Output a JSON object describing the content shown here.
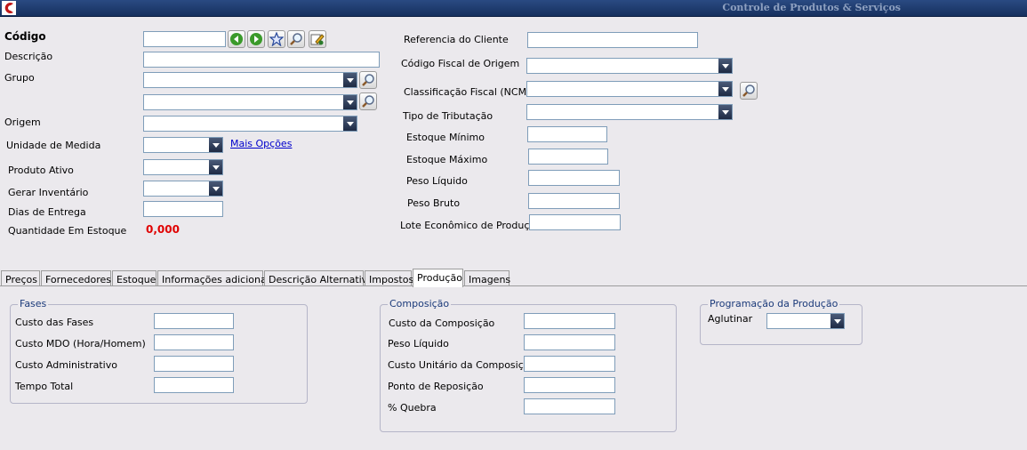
{
  "window": {
    "title": "Controle de Produtos & Serviços"
  },
  "left": {
    "codigo_label": "Código",
    "descricao_label": "Descrição",
    "grupo_label": "Grupo",
    "origem_label": "Origem",
    "unidade_label": "Unidade de Medida",
    "mais_opcoes": "Mais Opções",
    "produto_ativo_label": "Produto Ativo",
    "gerar_inventario_label": "Gerar Inventário",
    "dias_entrega_label": "Dias de Entrega",
    "qtd_estoque_label": "Quantidade Em Estoque",
    "qtd_estoque_value": "0,000"
  },
  "right": {
    "referencia_label": "Referencia do Cliente",
    "cfop_label": "Código Fiscal de Origem",
    "ncm_label": "Classificação Fiscal (NCM)",
    "tributacao_label": "Tipo de Tributação",
    "estoque_min_label": "Estoque Mínimo",
    "estoque_max_label": "Estoque Máximo",
    "peso_liquido_label": "Peso Líquido",
    "peso_bruto_label": "Peso Bruto",
    "lote_label": "Lote Econômico de Produção"
  },
  "tabs": [
    {
      "label": "Preços"
    },
    {
      "label": "Fornecedores"
    },
    {
      "label": "Estoque"
    },
    {
      "label": "Informações adicionais"
    },
    {
      "label": "Descrição Alternativa"
    },
    {
      "label": "Impostos"
    },
    {
      "label": "Produção",
      "active": true
    },
    {
      "label": "Imagens"
    }
  ],
  "fases": {
    "title": "Fases",
    "custo_fases": "Custo das Fases",
    "custo_mdo": "Custo MDO (Hora/Homem)",
    "custo_adm": "Custo Administrativo",
    "tempo_total": "Tempo Total"
  },
  "composicao": {
    "title": "Composição",
    "custo": "Custo da Composição",
    "peso_liquido": "Peso Líquido",
    "custo_unitario": "Custo Unitário da Composição",
    "ponto_reposicao": "Ponto de Reposição",
    "quebra": "% Quebra"
  },
  "programacao": {
    "title": "Programação da Produção",
    "aglutinar": "Aglutinar"
  },
  "icons": [
    "app-logo-icon",
    "back-arrow-icon",
    "forward-arrow-icon",
    "star-icon",
    "search-icon",
    "edit-icon",
    "dropdown-arrow-icon"
  ],
  "colors": {
    "titlebar": "#1e3a6e",
    "value_red": "#e00000",
    "link": "#0000cc",
    "group_title": "#1b3a7a"
  }
}
